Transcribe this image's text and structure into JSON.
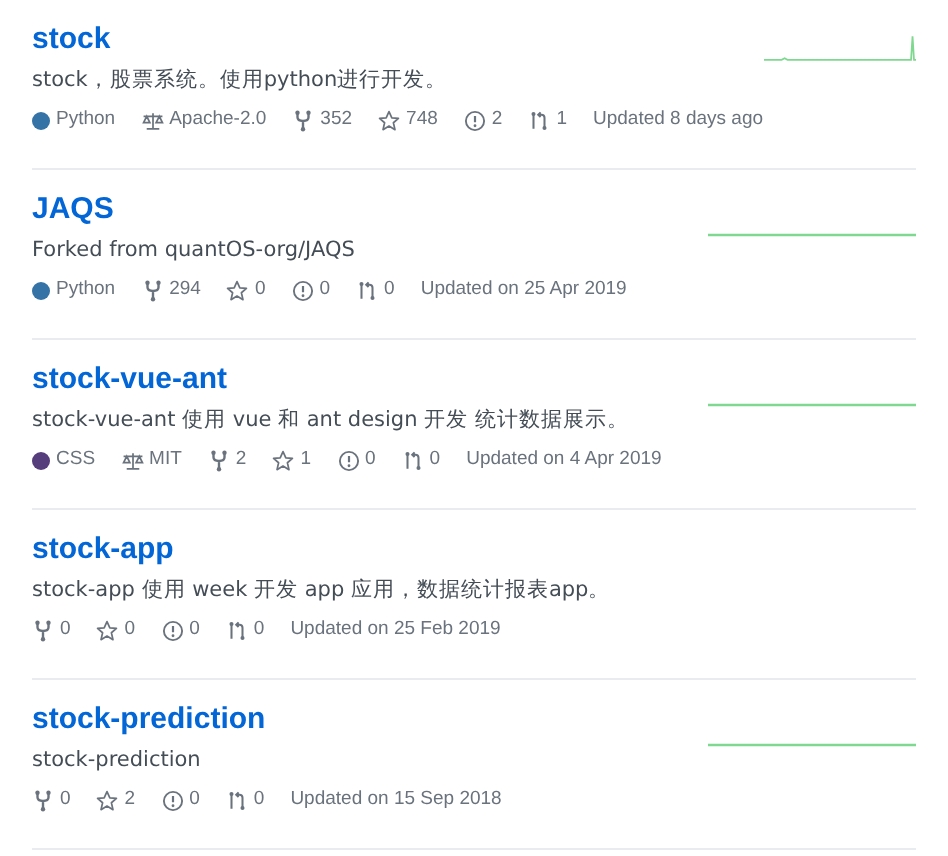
{
  "repositories": [
    {
      "name": "stock",
      "description": "stock，股票系统。使用python进行开发。",
      "language": {
        "name": "Python",
        "color": "#3572a5"
      },
      "license": "Apache-2.0",
      "forks": "352",
      "stars": "748",
      "issues": "2",
      "pull_requests": "1",
      "updated": "Updated 8 days ago",
      "sparkline": {
        "kind": "spike"
      }
    },
    {
      "name": "JAQS",
      "description": "Forked from quantOS-org/JAQS",
      "language": {
        "name": "Python",
        "color": "#3572a5"
      },
      "forks": "294",
      "stars": "0",
      "issues": "0",
      "pull_requests": "0",
      "updated": "Updated on 25 Apr 2019",
      "sparkline": {
        "kind": "flat"
      }
    },
    {
      "name": "stock-vue-ant",
      "description": "stock-vue-ant 使用 vue 和 ant design 开发 统计数据展示。",
      "language": {
        "name": "CSS",
        "color": "#563d7c"
      },
      "license": "MIT",
      "forks": "2",
      "stars": "1",
      "issues": "0",
      "pull_requests": "0",
      "updated": "Updated on 4 Apr 2019",
      "sparkline": {
        "kind": "flat"
      }
    },
    {
      "name": "stock-app",
      "description": "stock-app 使用 week 开发 app 应用，数据统计报表app。",
      "forks": "0",
      "stars": "0",
      "issues": "0",
      "pull_requests": "0",
      "updated": "Updated on 25 Feb 2019"
    },
    {
      "name": "stock-prediction",
      "description": "stock-prediction",
      "forks": "0",
      "stars": "2",
      "issues": "0",
      "pull_requests": "0",
      "updated": "Updated on 15 Sep 2018",
      "sparkline": {
        "kind": "flat"
      }
    }
  ]
}
